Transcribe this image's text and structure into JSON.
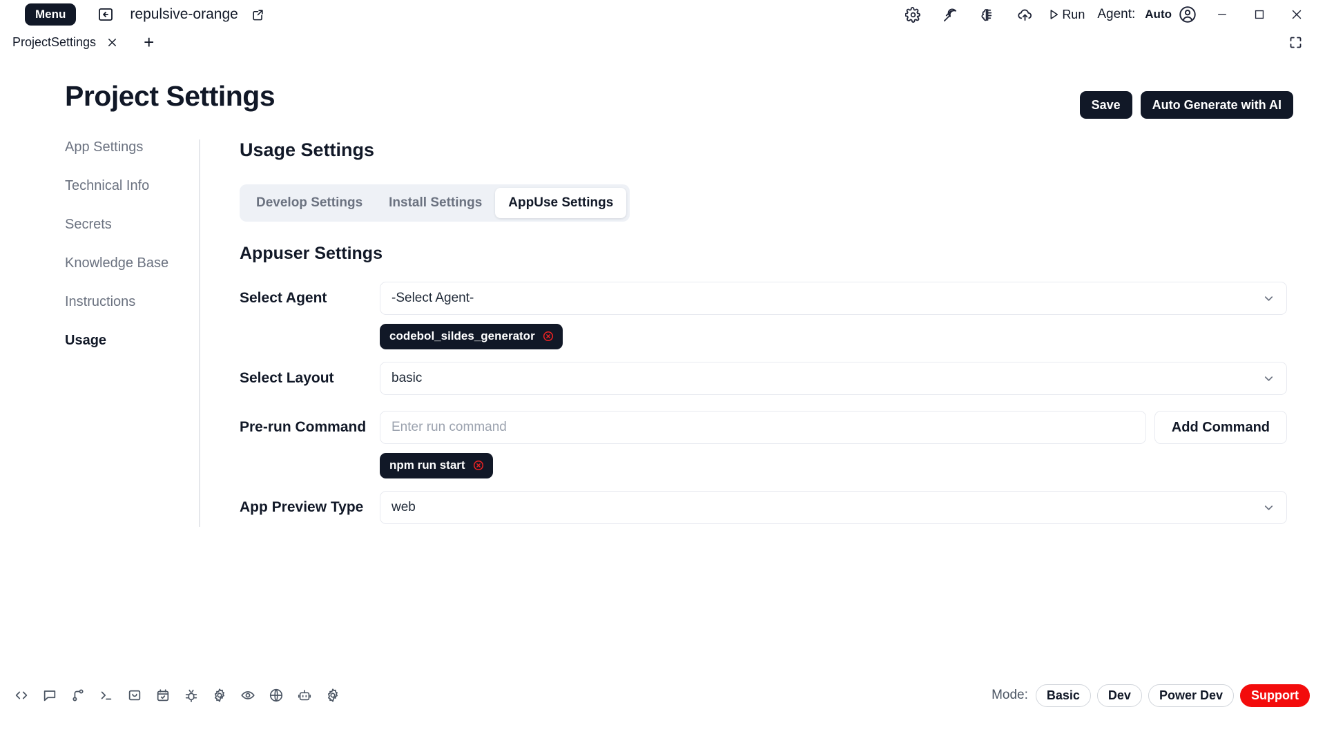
{
  "window": {
    "menu_label": "Menu",
    "project_name": "repulsive-orange",
    "back_icon": "back-arrow-boxed-icon",
    "external_icon": "external-link-icon",
    "toolbar_icons": [
      "gear-icon",
      "pickaxe-icon",
      "brain-circuit-icon",
      "cloud-upload-icon"
    ],
    "run_label": "Run",
    "agent_label": "Agent:",
    "agent_value": "Auto",
    "account_icon": "user-circle-icon",
    "minimize_icon": "minimize-icon",
    "maximize_icon": "maximize-icon",
    "close_icon": "close-icon"
  },
  "tabstrip": {
    "tabs": [
      {
        "label": "ProjectSettings",
        "close_icon": "close-icon"
      }
    ],
    "add_label": "+",
    "fullscreen_icon": "fullscreen-icon"
  },
  "header": {
    "title": "Project Settings",
    "save_label": "Save",
    "auto_generate_label": "Auto Generate with AI"
  },
  "sidebar": {
    "items": [
      {
        "label": "App Settings",
        "active": false
      },
      {
        "label": "Technical Info",
        "active": false
      },
      {
        "label": "Secrets",
        "active": false
      },
      {
        "label": "Knowledge Base",
        "active": false
      },
      {
        "label": "Instructions",
        "active": false
      },
      {
        "label": "Usage",
        "active": true
      }
    ]
  },
  "content": {
    "section_title": "Usage Settings",
    "tabs": [
      {
        "label": "Develop Settings",
        "active": false
      },
      {
        "label": "Install Settings",
        "active": false
      },
      {
        "label": "AppUse Settings",
        "active": true
      }
    ],
    "sub_title": "Appuser Settings",
    "fields": {
      "select_agent": {
        "label": "Select Agent",
        "value": "-Select Agent-",
        "chips": [
          {
            "label": "codebol_sildes_generator",
            "remove_icon": "remove-circle-icon"
          }
        ]
      },
      "select_layout": {
        "label": "Select Layout",
        "value": "basic"
      },
      "pre_run_command": {
        "label": "Pre-run Command",
        "value": "",
        "placeholder": "Enter run command",
        "add_button": "Add Command",
        "chips": [
          {
            "label": "npm run start",
            "remove_icon": "remove-circle-icon"
          }
        ]
      },
      "app_preview_type": {
        "label": "App Preview Type",
        "value": "web"
      }
    }
  },
  "statusbar": {
    "icons": [
      "code-brackets-icon",
      "chat-bubble-icon",
      "git-branch-icon",
      "terminal-icon",
      "inbox-icon",
      "calendar-check-icon",
      "bug-icon",
      "gear-icon",
      "eye-icon",
      "globe-icon",
      "robot-icon",
      "gear-icon"
    ],
    "mode_label": "Mode:",
    "modes": [
      {
        "label": "Basic",
        "style": "default"
      },
      {
        "label": "Dev",
        "style": "default"
      },
      {
        "label": "Power Dev",
        "style": "default"
      },
      {
        "label": "Support",
        "style": "support"
      }
    ]
  },
  "colors": {
    "dark": "#111827",
    "accent_red": "#f30c0c",
    "chip_bg": "#111827",
    "muted": "#6b7280",
    "tabgroup_bg": "#eef1f6"
  }
}
